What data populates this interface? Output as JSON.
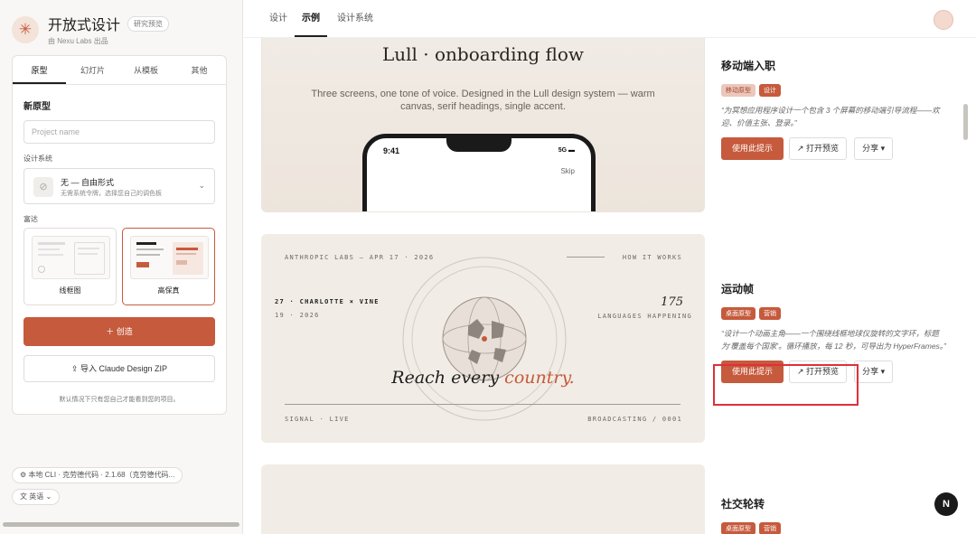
{
  "brand": {
    "title": "开放式设计",
    "badge": "研究预览",
    "subtitle": "由 Nexu Labs 出品"
  },
  "sidebar": {
    "tabs": [
      {
        "label": "原型"
      },
      {
        "label": "幻灯片"
      },
      {
        "label": "从模板"
      },
      {
        "label": "其他"
      }
    ],
    "section_title": "新原型",
    "project_placeholder": "Project name",
    "design_system_label": "设计系统",
    "design_system": {
      "main": "无 — 自由形式",
      "sub": "无需系统令牌，选择您自己的调色板"
    },
    "fidelity_label": "富达",
    "fidelity_options": [
      {
        "label": "线框图"
      },
      {
        "label": "高保真"
      }
    ],
    "create_label": "＋ 创造",
    "import_label": "导入 Claude Design ZIP",
    "note": "默认情况下只有您自己才能看到您的项目。",
    "cli_pill": "本地 CLI · 克劳德代码 · 2.1.68（克劳德代码...",
    "lang_pill": "英语"
  },
  "topnav": {
    "items": [
      {
        "label": "设计"
      },
      {
        "label": "示例"
      },
      {
        "label": "设计系统"
      }
    ]
  },
  "cards": [
    {
      "preview": {
        "title": "Lull · onboarding flow",
        "subtitle": "Three screens, one tone of voice. Designed in the Lull design system — warm canvas, serif headings, single accent.",
        "time": "9:41",
        "signal": "5G",
        "skip": "Skip"
      },
      "title": "移动端入职",
      "tags": [
        "移动原型",
        "设计"
      ],
      "desc": "“为冥想应用程序设计一个包含 3 个屏幕的移动端引导流程——欢迎、价值主张、登录。”"
    },
    {
      "preview": {
        "header_left": "ANTHROPIC LABS — APR 17 · 2026",
        "header_right": "HOW IT WORKS",
        "line1": "27 · CHARLOTTE × VINE",
        "line2": "19 · 2026",
        "number": "175",
        "number_label": "LANGUAGES HAPPENING",
        "reach": "Reach every",
        "reach_accent": "country.",
        "footer_left": "SIGNAL · LIVE",
        "footer_right": "BROADCASTING / 0001"
      },
      "title": "运动帧",
      "tags": [
        "桌面原型",
        "营销"
      ],
      "desc": "“设计一个动画主角——一个围绕线框地球仪旋转的文字环，标题为‘覆盖每个国家’。循环播放，每 12 秒，可导出为 HyperFrames。”"
    },
    {
      "title": "社交轮转",
      "tags": [
        "桌面原型",
        "营销"
      ]
    }
  ],
  "actions": {
    "use": "使用此提示",
    "open": "↗ 打开预览",
    "share": "分享 ▾"
  },
  "floating_badge": "N",
  "colors": {
    "accent": "#c65a3c",
    "highlight": "#e02f3a"
  }
}
